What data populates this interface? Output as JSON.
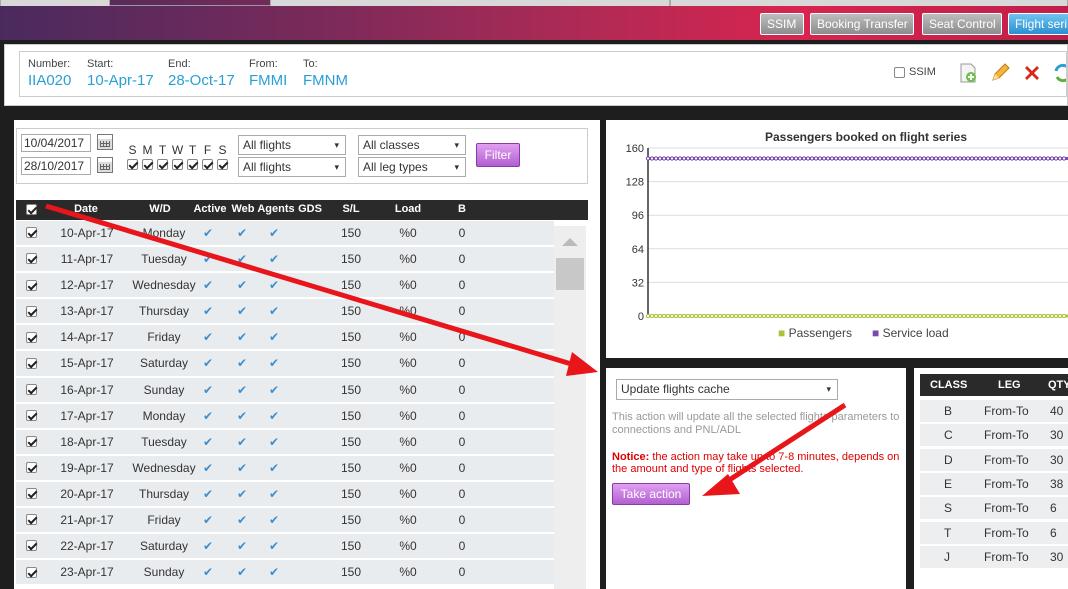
{
  "topnav": {
    "buttons": [
      "SSIM",
      "Booking Transfer",
      "Seat Control",
      "Flight seri"
    ],
    "active_index": 3
  },
  "flight_info": {
    "number_label": "Number:",
    "number": "IIA020",
    "start_label": "Start:",
    "start": "10-Apr-17",
    "end_label": "End:",
    "end": "28-Oct-17",
    "from_label": "From:",
    "from": "FMMI",
    "to_label": "To:",
    "to": "FMNM",
    "ssim_label": "SSIM"
  },
  "icons": {
    "add": "add-document-icon",
    "edit": "pencil-icon",
    "delete": "delete-x-icon",
    "refresh": "refresh-icon"
  },
  "filters": {
    "date_from": "10/04/2017",
    "date_to": "28/10/2017",
    "days": [
      "S",
      "M",
      "T",
      "W",
      "T",
      "F",
      "S"
    ],
    "flights_select_1": "All flights",
    "flights_select_2": "All flights",
    "classes_select": "All classes",
    "leg_types_select": "All leg types",
    "filter_button": "Filter"
  },
  "table": {
    "headers": [
      "Date",
      "W/D",
      "Active",
      "Web",
      "Agents",
      "GDS",
      "S/L",
      "Load",
      "B"
    ],
    "rows": [
      {
        "date": "10-Apr-17",
        "wd": "Monday",
        "sl": "150",
        "load": "%0",
        "b": "0"
      },
      {
        "date": "11-Apr-17",
        "wd": "Tuesday",
        "sl": "150",
        "load": "%0",
        "b": "0"
      },
      {
        "date": "12-Apr-17",
        "wd": "Wednesday",
        "sl": "150",
        "load": "%0",
        "b": "0"
      },
      {
        "date": "13-Apr-17",
        "wd": "Thursday",
        "sl": "150",
        "load": "%0",
        "b": "0"
      },
      {
        "date": "14-Apr-17",
        "wd": "Friday",
        "sl": "150",
        "load": "%0",
        "b": "0"
      },
      {
        "date": "15-Apr-17",
        "wd": "Saturday",
        "sl": "150",
        "load": "%0",
        "b": "0"
      },
      {
        "date": "16-Apr-17",
        "wd": "Sunday",
        "sl": "150",
        "load": "%0",
        "b": "0"
      },
      {
        "date": "17-Apr-17",
        "wd": "Monday",
        "sl": "150",
        "load": "%0",
        "b": "0"
      },
      {
        "date": "18-Apr-17",
        "wd": "Tuesday",
        "sl": "150",
        "load": "%0",
        "b": "0"
      },
      {
        "date": "19-Apr-17",
        "wd": "Wednesday",
        "sl": "150",
        "load": "%0",
        "b": "0"
      },
      {
        "date": "20-Apr-17",
        "wd": "Thursday",
        "sl": "150",
        "load": "%0",
        "b": "0"
      },
      {
        "date": "21-Apr-17",
        "wd": "Friday",
        "sl": "150",
        "load": "%0",
        "b": "0"
      },
      {
        "date": "22-Apr-17",
        "wd": "Saturday",
        "sl": "150",
        "load": "%0",
        "b": "0"
      },
      {
        "date": "23-Apr-17",
        "wd": "Sunday",
        "sl": "150",
        "load": "%0",
        "b": "0"
      }
    ]
  },
  "chart_data": {
    "type": "line",
    "title": "Passengers booked on flight series",
    "yticks": [
      0,
      32,
      64,
      96,
      128,
      160
    ],
    "ylim": [
      0,
      160
    ],
    "series": [
      {
        "name": "Passengers",
        "color": "#a8c43a",
        "value": 0
      },
      {
        "name": "Service load",
        "color": "#7a4ab0",
        "value": 150
      }
    ],
    "legend": "bottom",
    "grid": true
  },
  "action": {
    "select_value": "Update flights cache",
    "description": "This action will update all the selected flights parameters to connections and PNL/ADL",
    "notice_label": "Notice:",
    "notice_text": " the action may take up to 7-8 minutes, depends on the amount and type of flights selected.",
    "button": "Take action"
  },
  "class_table": {
    "headers": [
      "CLASS",
      "LEG",
      "QTY"
    ],
    "rows": [
      {
        "class": "B",
        "leg": "From-To",
        "qty": "40"
      },
      {
        "class": "C",
        "leg": "From-To",
        "qty": "30"
      },
      {
        "class": "D",
        "leg": "From-To",
        "qty": "30"
      },
      {
        "class": "E",
        "leg": "From-To",
        "qty": "38"
      },
      {
        "class": "S",
        "leg": "From-To",
        "qty": "6"
      },
      {
        "class": "T",
        "leg": "From-To",
        "qty": "6"
      },
      {
        "class": "J",
        "leg": "From-To",
        "qty": "30"
      }
    ]
  },
  "colors": {
    "accent_blue": "#2a9fd6",
    "action_purple": "#b060d0",
    "annotation_red": "#e8161b"
  }
}
